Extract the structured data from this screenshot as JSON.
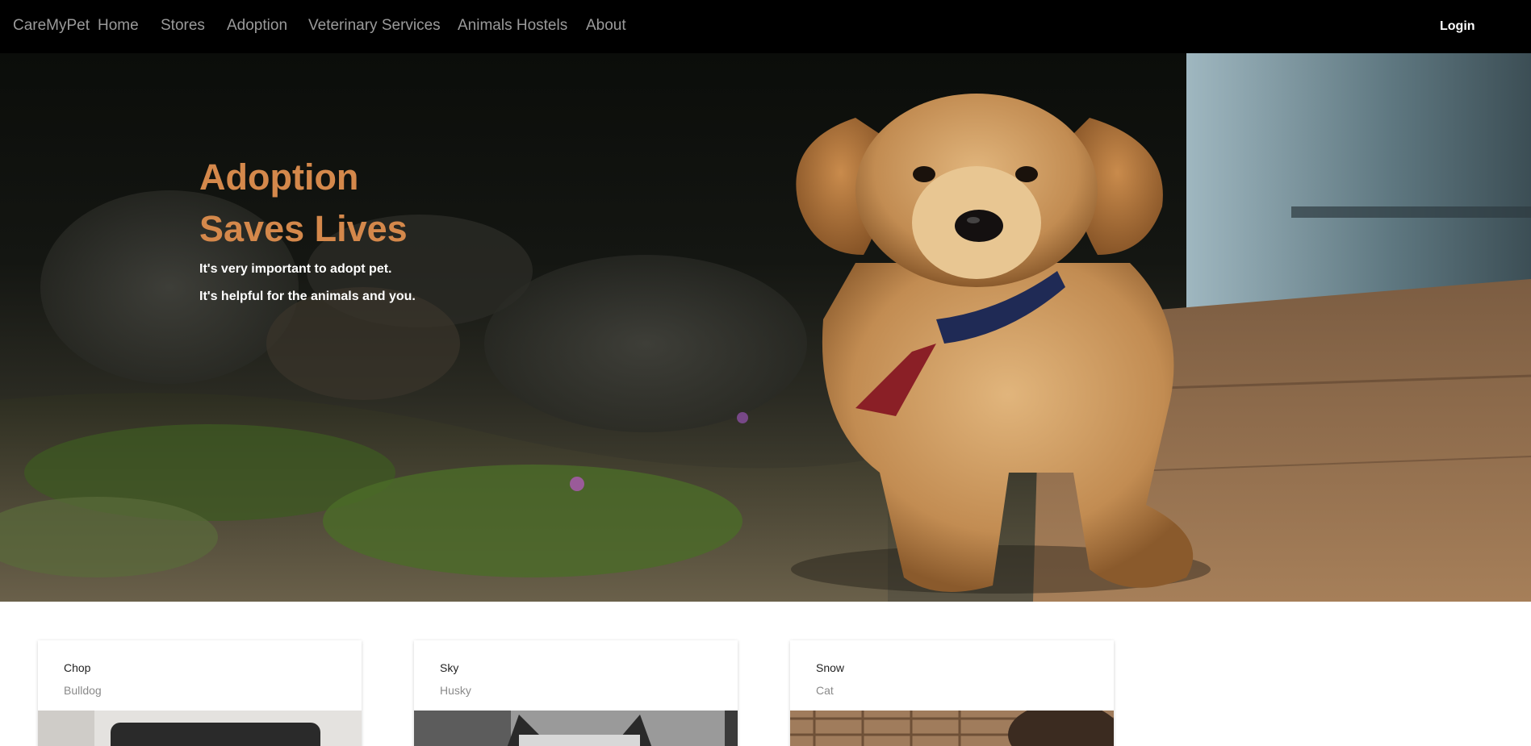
{
  "nav": {
    "brand": "CareMyPet",
    "links": [
      "Home",
      "Stores",
      "Adoption",
      "Veterinary Services",
      "Animals Hostels",
      "About"
    ],
    "login": "Login"
  },
  "hero": {
    "title_line1": "Adoption",
    "title_line2": "Saves Lives",
    "sub_line1": "It's very important to adopt pet.",
    "sub_line2": "It's helpful for the animals and you.",
    "title_color": "#d4884b"
  },
  "pets": [
    {
      "name": "Chop",
      "breed": "Bulldog"
    },
    {
      "name": "Sky",
      "breed": "Husky"
    },
    {
      "name": "Snow",
      "breed": "Cat"
    }
  ]
}
